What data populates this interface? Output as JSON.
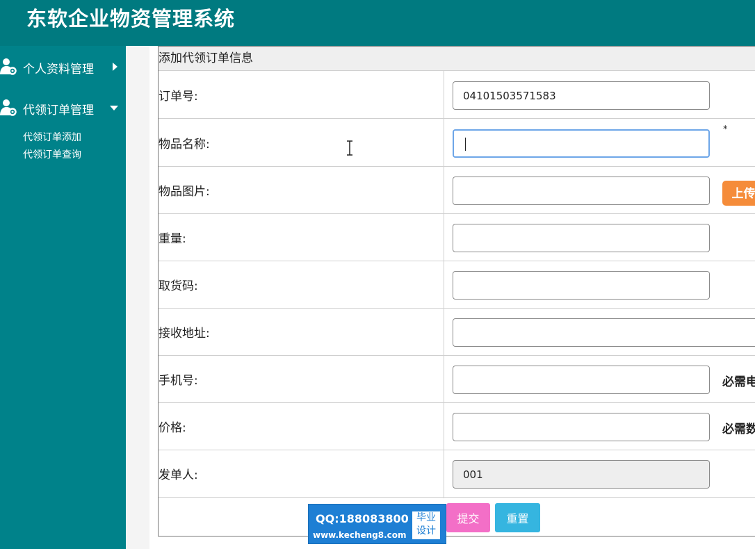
{
  "app": {
    "title": "东软企业物资管理系统"
  },
  "sidebar": {
    "groups": [
      {
        "label": "个人资料管理",
        "expanded": false
      },
      {
        "label": "代领订单管理",
        "expanded": true,
        "items": [
          "代领订单添加",
          "代领订单查询"
        ]
      }
    ]
  },
  "form": {
    "section_title": "添加代领订单信息",
    "fields": [
      {
        "label": "订单号:",
        "value": "04101503571583"
      },
      {
        "label": "物品名称:",
        "value": "",
        "required_mark": "*"
      },
      {
        "label": "物品图片:",
        "value": "",
        "button": "上传"
      },
      {
        "label": "重量:",
        "value": ""
      },
      {
        "label": "取货码:",
        "value": ""
      },
      {
        "label": "接收地址:",
        "value": ""
      },
      {
        "label": "手机号:",
        "value": "",
        "hint": "必需电"
      },
      {
        "label": "价格:",
        "value": "",
        "hint": "必需数"
      },
      {
        "label": "发单人:",
        "value": "001",
        "readonly": true
      }
    ],
    "submit_label": "提交",
    "reset_label": "重置"
  },
  "watermark": {
    "qq": "QQ:188083800",
    "url": "www.kecheng8.com",
    "badge_line1": "毕业",
    "badge_line2": "设计"
  },
  "colors": {
    "header": "#007a80",
    "sidebar": "#00828a",
    "upload": "#f58c3a",
    "submit": "#f36fc7",
    "reset": "#35b5e0"
  }
}
